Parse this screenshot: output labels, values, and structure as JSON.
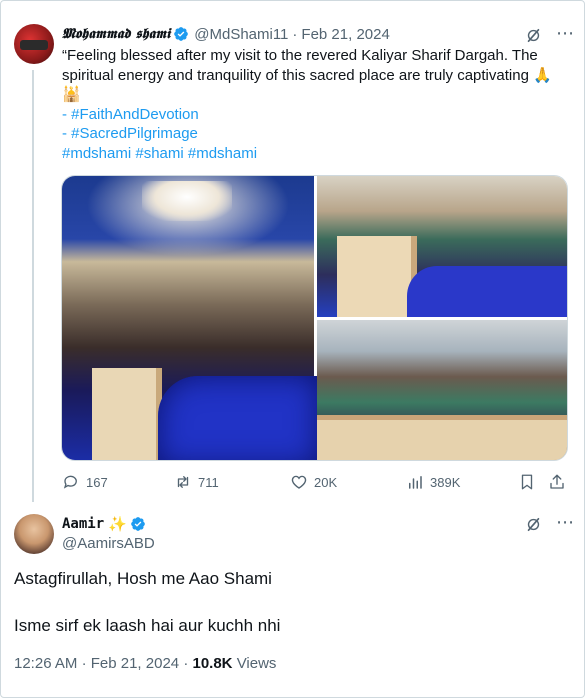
{
  "quoted_tweet": {
    "display_name": "𝕸𝖔𝖍𝖆𝖒𝖒𝖆𝖉 𝖘𝖍𝖆𝖒𝖎",
    "handle": "@MdShami11",
    "separator": "·",
    "date": "Feb 21, 2024",
    "text_line1": "“Feeling blessed after my visit to the revered Kaliyar Sharif Dargah. The",
    "text_line2": "spiritual energy and tranquility of this sacred place are truly captivating 🙏",
    "text_line3": "🕌",
    "hashtag_line1": "- #FaithAndDevotion",
    "hashtag_line2": "- #SacredPilgrimage",
    "hashtag_line3": "#mdshami #shami #mdshami",
    "stats": {
      "replies": "167",
      "reposts": "711",
      "likes": "20K",
      "views": "389K"
    }
  },
  "reply_tweet": {
    "display_name": "Aamir",
    "sparkle": "✨",
    "handle": "@AamirsABD",
    "text_line1": "Astagfirullah, Hosh me Aao Shami",
    "text_line2": "Isme sirf ek laash hai aur kuchh nhi",
    "time": "12:26 AM",
    "date": "Feb 21, 2024",
    "views_count": "10.8K",
    "views_label": "Views"
  },
  "colors": {
    "verified": "#1d9bf0",
    "link": "#1d9bf0",
    "muted": "#536471",
    "text": "#0f1419"
  },
  "icons": {
    "more": "more-dots-icon",
    "grok": "grok-icon",
    "reply": "reply-icon",
    "repost": "repost-icon",
    "like": "heart-icon",
    "views": "views-bar-icon",
    "bookmark": "bookmark-icon",
    "share": "share-icon"
  }
}
